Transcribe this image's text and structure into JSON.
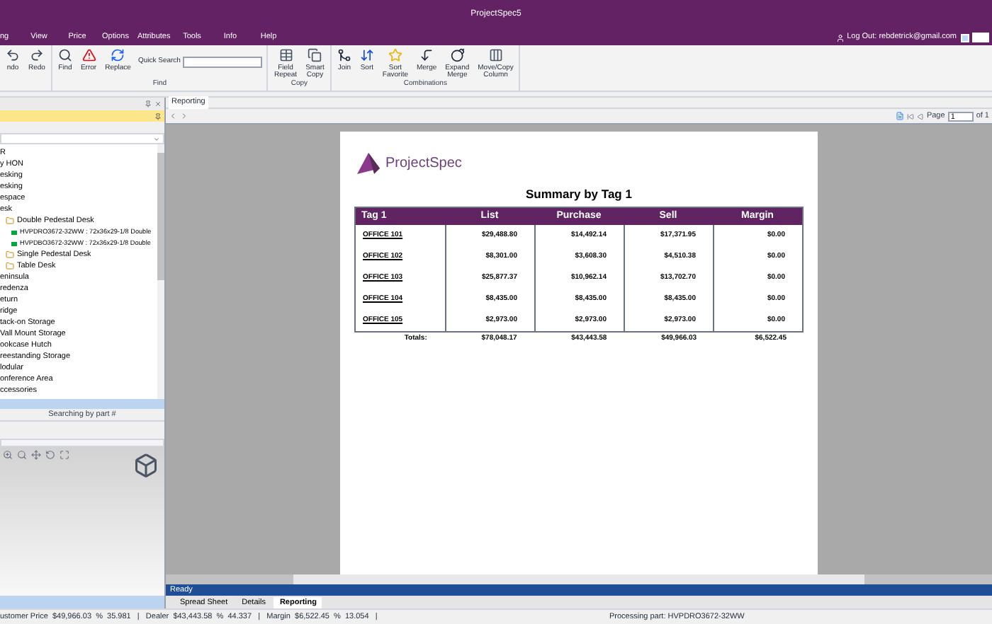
{
  "window": {
    "title": "ProjectSpec5"
  },
  "menu": [
    "ng",
    "View",
    "Price",
    "Options",
    "Attributes",
    "Tools",
    "Info",
    "Help"
  ],
  "account": {
    "label": "Log Out: rebdetrick@gmail.com"
  },
  "ribbon": {
    "groups": [
      {
        "buttons": [
          {
            "label": "ndo",
            "kind": "undo"
          },
          {
            "label": "Redo",
            "kind": "redo"
          }
        ]
      },
      {
        "label": "Find",
        "buttons": [
          {
            "label": "Find",
            "kind": "find"
          },
          {
            "label": "Error",
            "kind": "error"
          },
          {
            "label": "Replace",
            "kind": "replace"
          }
        ],
        "search": {
          "label": "Quick Search"
        }
      },
      {
        "label": "Copy",
        "buttons": [
          {
            "label": "Field\nRepeat",
            "kind": "table"
          },
          {
            "label": "Smart\nCopy",
            "kind": "copy"
          }
        ]
      },
      {
        "label": "Combinations",
        "buttons": [
          {
            "label": "Join",
            "kind": "join"
          },
          {
            "label": "Sort",
            "kind": "sort"
          },
          {
            "label": "Sort\nFavorite",
            "kind": "sortfav"
          },
          {
            "label": "Merge",
            "kind": "merge"
          },
          {
            "label": "Expand\nMerge",
            "kind": "bomb"
          },
          {
            "label": "Move/Copy\nColumn",
            "kind": "column"
          }
        ]
      }
    ]
  },
  "tree": [
    {
      "label": "R"
    },
    {
      "label": "y HON"
    },
    {
      "label": "esking"
    },
    {
      "label": "esking"
    },
    {
      "label": "espace"
    },
    {
      "label": "esk",
      "children": [
        {
          "label": "Double Pedestal Desk",
          "kind": "group",
          "children": [
            {
              "label": "HVPDRO3672-32WW : 72x36x29-1/8 Double",
              "kind": "part"
            },
            {
              "label": "HVPDBO3672-32WW : 72x36x29-1/8 Double",
              "kind": "part"
            }
          ]
        },
        {
          "label": "Single Pedestal Desk",
          "kind": "group"
        },
        {
          "label": "Table Desk",
          "kind": "group"
        }
      ]
    },
    {
      "label": "eninsula"
    },
    {
      "label": "redenza"
    },
    {
      "label": "eturn"
    },
    {
      "label": "ridge"
    },
    {
      "label": "tack-on Storage"
    },
    {
      "label": "Vall Mount Storage"
    },
    {
      "label": "ookcase Hutch"
    },
    {
      "label": "reestanding Storage"
    },
    {
      "label": "lodular"
    },
    {
      "label": "onference Area"
    },
    {
      "label": "ccessories"
    }
  ],
  "search_mode": "Searching by part #",
  "document_tab": "Reporting",
  "report_toolbar": {
    "page_label": "Page",
    "page": "1",
    "of": "of 1"
  },
  "report": {
    "logo": "ProjectSpec",
    "title": "Summary by Tag 1",
    "columns": [
      "Tag 1",
      "List",
      "Purchase",
      "Sell",
      "Margin"
    ],
    "rows": [
      [
        "OFFICE 101",
        "$29,488.80",
        "$14,492.14",
        "$17,371.95",
        "$0.00"
      ],
      [
        "OFFICE 102",
        "$8,301.00",
        "$3,608.30",
        "$4,510.38",
        "$0.00"
      ],
      [
        "OFFICE 103",
        "$25,877.37",
        "$10,962.14",
        "$13,702.70",
        "$0.00"
      ],
      [
        "OFFICE 104",
        "$8,435.00",
        "$8,435.00",
        "$8,435.00",
        "$0.00"
      ],
      [
        "OFFICE 105",
        "$2,973.00",
        "$2,973.00",
        "$2,973.00",
        "$0.00"
      ]
    ],
    "totals": [
      "Totals:",
      "$78,048.17",
      "$43,443.58",
      "$49,966.03",
      "$6,522.45"
    ]
  },
  "ready": "Ready",
  "bottom_tabs": [
    {
      "label": "Spread Sheet",
      "selected": false
    },
    {
      "label": "Details",
      "selected": false
    },
    {
      "label": "Reporting",
      "selected": true
    }
  ],
  "status_bar": {
    "totals": "ustomer Price  $49,966.03  %  35.981   |   Dealer  $43,443.58  %  44.337   |   Margin  $6,522.45  %  13.054   |",
    "processing": "Processing part: HVPDRO3672-32WW"
  }
}
